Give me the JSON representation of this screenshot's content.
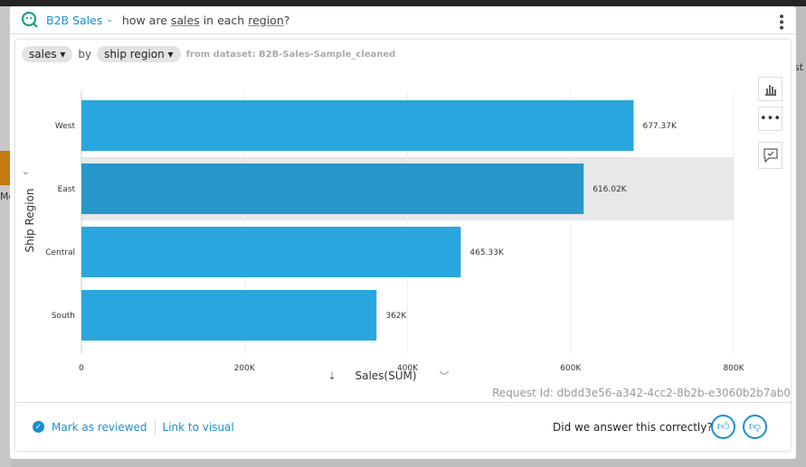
{
  "background": {
    "left_fragment": "Me",
    "right_fragment": "st"
  },
  "query_bar": {
    "topic": "B2B Sales",
    "question_parts": [
      "how are ",
      "sales",
      " in each ",
      "region",
      "?"
    ]
  },
  "filters": {
    "measure": "sales",
    "by": "by",
    "dimension": "ship region",
    "dataset": "from dataset: B2B-Sales-Sample_cleaned"
  },
  "side_buttons": [
    {
      "icon": "bar-chart-icon"
    },
    {
      "icon": "more-icon"
    },
    {
      "icon": "feedback-icon"
    }
  ],
  "request_id": "Request Id: dbdd3e56-a342-4cc2-8b2b-e3060b2b7ab0",
  "footer": {
    "mark_reviewed": "Mark as reviewed",
    "link_to_visual": "Link to visual",
    "feedback_question": "Did we answer this correctly?"
  },
  "colors": {
    "bar": "#29a6de",
    "bar_highlight": "#2898ca",
    "accent": "#1a8fd0"
  },
  "chart_data": {
    "type": "bar",
    "orientation": "horizontal",
    "categories": [
      "West",
      "East",
      "Central",
      "South"
    ],
    "values": [
      677370,
      616020,
      465330,
      362000
    ],
    "data_labels": [
      "677.37K",
      "616.02K",
      "465.33K",
      "362K"
    ],
    "xlabel": "Sales(SUM)",
    "ylabel": "Ship Region",
    "xlim": [
      0,
      800000
    ],
    "xticks": [
      0,
      200000,
      400000,
      600000,
      800000
    ],
    "xtick_labels": [
      "0",
      "200K",
      "400K",
      "600K",
      "800K"
    ],
    "grid": true,
    "highlighted": "East"
  }
}
